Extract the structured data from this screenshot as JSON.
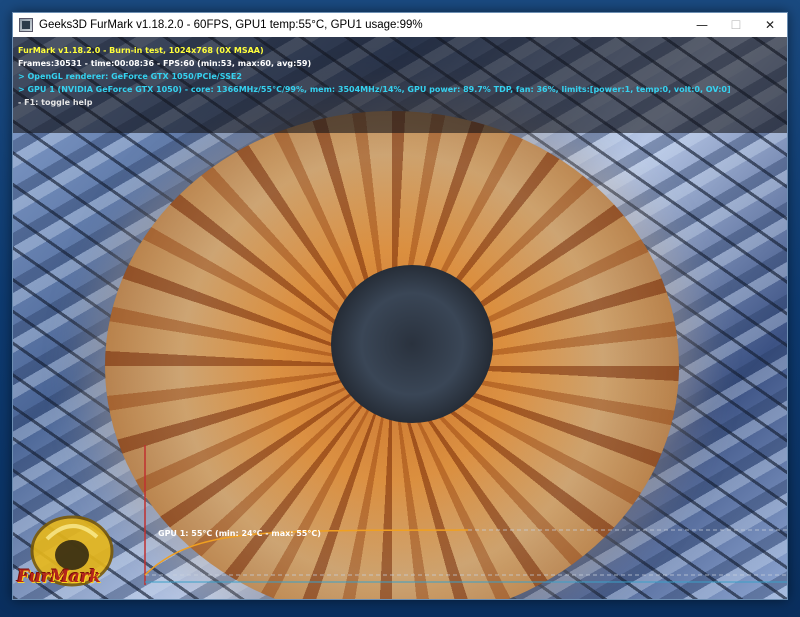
{
  "window": {
    "title": "Geeks3D FurMark v1.18.2.0 - 60FPS, GPU1 temp:55°C, GPU1 usage:99%",
    "minimize_glyph": "—",
    "maximize_glyph": "☐",
    "close_glyph": "✕"
  },
  "hud": {
    "line1": "FurMark v1.18.2.0 - Burn-in test, 1024x768 (0X MSAA)",
    "line2": "Frames:30531 - time:00:08:36 - FPS:60 (min:53, max:60, avg:59)",
    "line3": "> OpenGL renderer: GeForce GTX 1050/PCIe/SSE2",
    "line4": "> GPU 1 (NVIDIA GeForce GTX 1050) - core: 1366MHz/55°C/99%, mem: 3504MHz/14%, GPU power: 89.7% TDP, fan: 36%, limits:[power:1, temp:0, volt:0, OV:0]",
    "line5": "- F1: toggle help"
  },
  "temperature_graph": {
    "label": "GPU 1: 55°C (min: 24°C - max: 55°C)",
    "current_c": 55,
    "min_c": 24,
    "max_c": 55,
    "line_color": "#f0a020",
    "axis_color": "#c03030",
    "baseline_color": "#3aa0c8"
  },
  "logo": {
    "text": "FurMark"
  },
  "colors": {
    "hud_title": "#ffff3b",
    "hud_info": "#35d2f0",
    "hud_text": "#ffffff"
  }
}
